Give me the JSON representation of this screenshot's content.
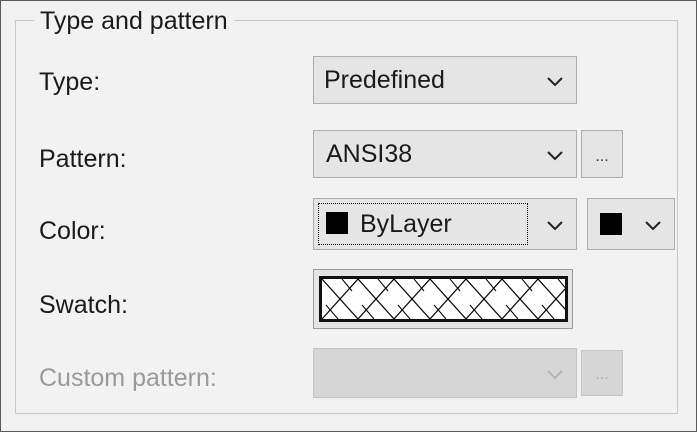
{
  "group": {
    "title": "Type and pattern"
  },
  "fields": {
    "type": {
      "label": "Type:",
      "value": "Predefined"
    },
    "pattern": {
      "label": "Pattern:",
      "value": "ANSI38",
      "browse_label": "..."
    },
    "color": {
      "label": "Color:",
      "value": "ByLayer",
      "swatch_color": "#000000",
      "background_color_value": "#000000"
    },
    "swatch": {
      "label": "Swatch:",
      "pattern_name": "ANSI38"
    },
    "custom_pattern": {
      "label": "Custom pattern:",
      "value": "",
      "browse_label": "...",
      "enabled": false
    }
  },
  "icons": {
    "dropdown": "chevron-down-icon",
    "color": "color-square-icon"
  },
  "colors": {
    "panel": "#f2f2f2",
    "control": "#e5e5e5",
    "disabled_text": "#9a9a9a"
  }
}
